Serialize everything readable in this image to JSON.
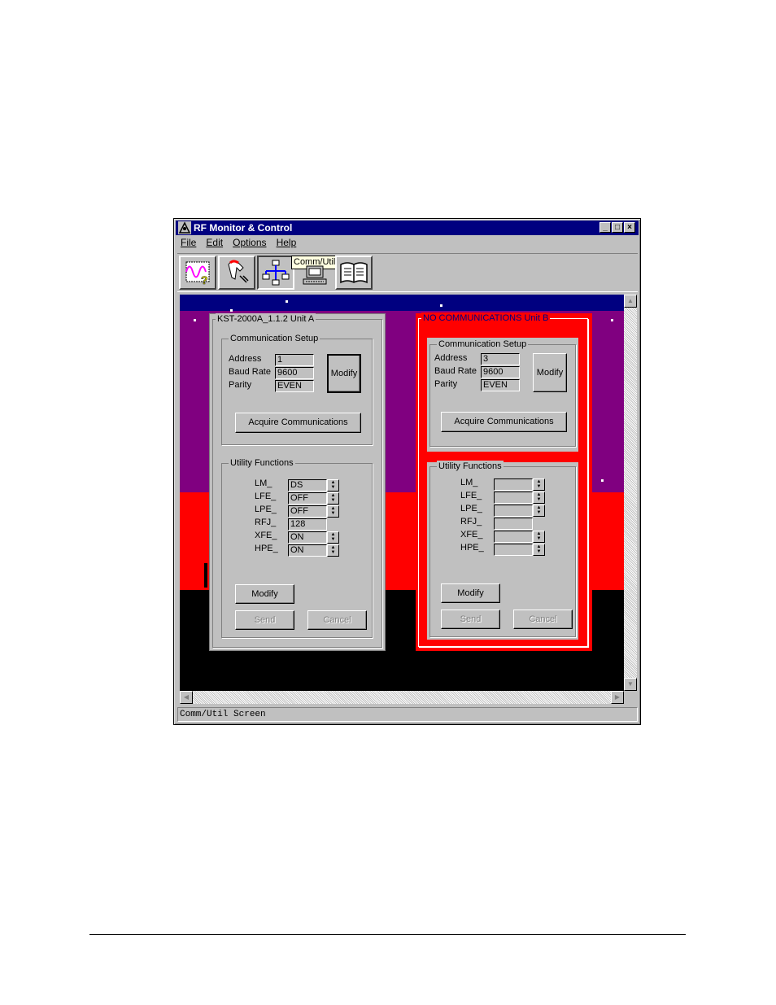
{
  "window": {
    "title": "RF Monitor & Control",
    "controls": {
      "minimize": "_",
      "maximize": "□",
      "close": "×"
    }
  },
  "menu": {
    "items": [
      {
        "label": "File",
        "mnemonic": "F"
      },
      {
        "label": "Edit",
        "mnemonic": "E"
      },
      {
        "label": "Options",
        "mnemonic": "O"
      },
      {
        "label": "Help",
        "mnemonic": "H"
      }
    ]
  },
  "toolbar": {
    "buttons": [
      {
        "name": "monitor",
        "icon": "waveform-help-icon"
      },
      {
        "name": "control",
        "icon": "hand-icon"
      },
      {
        "name": "comm-util",
        "icon": "network-icon"
      },
      {
        "name": "terminal",
        "icon": "computer-icon"
      },
      {
        "name": "manual",
        "icon": "book-icon"
      }
    ],
    "tooltip": "Comm/Util"
  },
  "unit_a": {
    "title": "KST-2000A_1.1.2 Unit A",
    "comm_setup": {
      "title": "Communication Setup",
      "address_label": "Address",
      "address": "1",
      "baud_label": "Baud Rate",
      "baud": "9600",
      "parity_label": "Parity",
      "parity": "EVEN",
      "modify_label": "Modify",
      "acquire_label": "Acquire Communications"
    },
    "utility": {
      "title": "Utility Functions",
      "rows": [
        {
          "label": "LM_",
          "value": "DS"
        },
        {
          "label": "LFE_",
          "value": "OFF"
        },
        {
          "label": "LPE_",
          "value": "OFF"
        },
        {
          "label": "RFJ_",
          "value": "128"
        },
        {
          "label": "XFE_",
          "value": "ON"
        },
        {
          "label": "HPE_",
          "value": "ON"
        }
      ],
      "modify_label": "Modify",
      "send_label": "Send",
      "cancel_label": "Cancel"
    }
  },
  "unit_b": {
    "title": "NO COMMUNICATIONS Unit B",
    "comm_setup": {
      "title": "Communication Setup",
      "address_label": "Address",
      "address": "3",
      "baud_label": "Baud Rate",
      "baud": "9600",
      "parity_label": "Parity",
      "parity": "EVEN",
      "modify_label": "Modify",
      "acquire_label": "Acquire Communications"
    },
    "utility": {
      "title": "Utility Functions",
      "rows": [
        {
          "label": "LM_",
          "value": ""
        },
        {
          "label": "LFE_",
          "value": ""
        },
        {
          "label": "LPE_",
          "value": ""
        },
        {
          "label": "RFJ_",
          "value": ""
        },
        {
          "label": "XFE_",
          "value": ""
        },
        {
          "label": "HPE_",
          "value": ""
        }
      ],
      "modify_label": "Modify",
      "send_label": "Send",
      "cancel_label": "Cancel"
    }
  },
  "status": {
    "text": "Comm/Util Screen"
  },
  "colors": {
    "titlebar": "#000080",
    "band_blue": "#000080",
    "band_purple": "#800080",
    "band_red": "#ff0000",
    "alarm_panel": "#ff0000",
    "alarm_title_text": "#ff0000"
  }
}
